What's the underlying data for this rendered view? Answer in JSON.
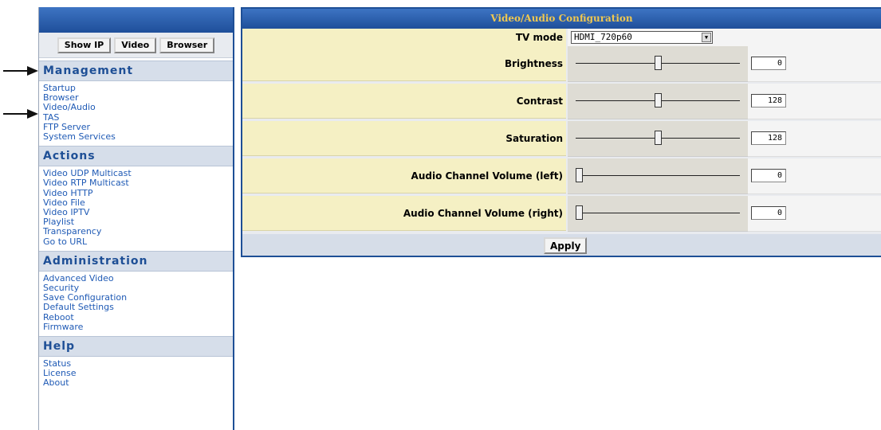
{
  "sidebar": {
    "buttons": [
      "Show IP",
      "Video",
      "Browser"
    ],
    "sections": [
      {
        "title": "Management",
        "links": [
          "Startup",
          "Browser",
          "Video/Audio",
          "TAS",
          "FTP Server",
          "System Services"
        ]
      },
      {
        "title": "Actions",
        "links": [
          "Video UDP Multicast",
          "Video RTP Multicast",
          "Video HTTP",
          "Video File",
          "Video IPTV",
          "Playlist",
          "Transparency",
          "Go to URL"
        ]
      },
      {
        "title": "Administration",
        "links": [
          "Advanced Video",
          "Security",
          "Save Configuration",
          "Default Settings",
          "Reboot",
          "Firmware"
        ]
      },
      {
        "title": "Help",
        "links": [
          "Status",
          "License",
          "About"
        ]
      }
    ]
  },
  "main": {
    "title": "Video/Audio Configuration",
    "tv_mode": {
      "label": "TV mode",
      "value": "HDMI_720p60"
    },
    "sliders": [
      {
        "label": "Brightness",
        "value": "0",
        "position": 0.5
      },
      {
        "label": "Contrast",
        "value": "128",
        "position": 0.5
      },
      {
        "label": "Saturation",
        "value": "128",
        "position": 0.5
      },
      {
        "label": "Audio Channel Volume (left)",
        "value": "0",
        "position": 0.0
      },
      {
        "label": "Audio Channel Volume (right)",
        "value": "0",
        "position": 0.0
      }
    ],
    "apply_label": "Apply"
  },
  "colors": {
    "accent": "#1e4f96",
    "header_text": "#f0c850",
    "label_bg": "#f5f0c4",
    "link": "#1f5ab5"
  }
}
